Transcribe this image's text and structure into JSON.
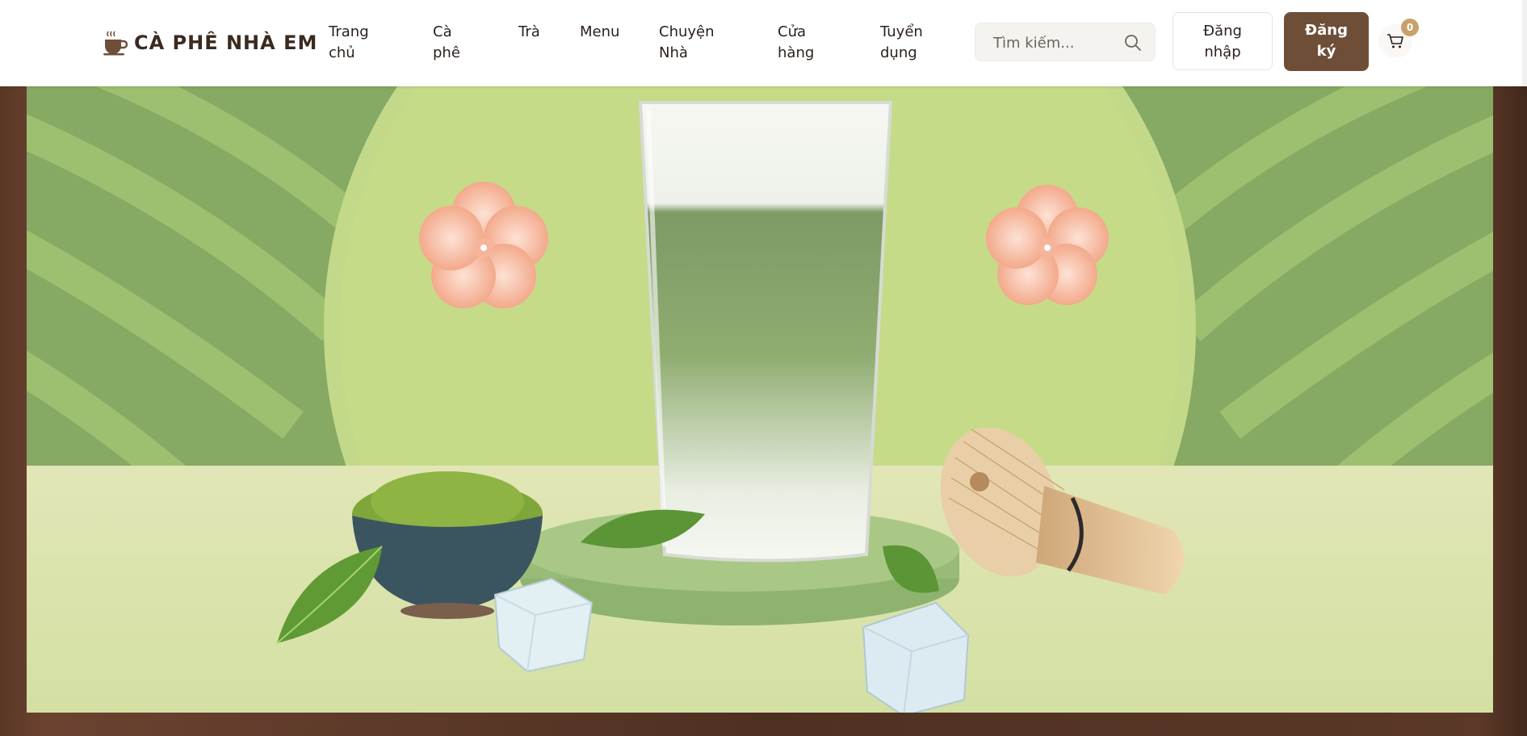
{
  "brand": {
    "name": "CÀ PHÊ NHÀ EM",
    "icon": "coffee-cup-icon"
  },
  "nav": [
    {
      "label": "Trang\nchủ"
    },
    {
      "label": "Cà\nphê"
    },
    {
      "label": "Trà"
    },
    {
      "label": "Menu"
    },
    {
      "label": "Chuyện\nNhà"
    },
    {
      "label": "Cửa\nhàng"
    },
    {
      "label": "Tuyển\ndụng"
    }
  ],
  "search": {
    "placeholder": "Tìm kiếm...",
    "icon": "search-icon"
  },
  "auth": {
    "login_label": "Đăng\nnhập",
    "register_label": "Đăng\nký"
  },
  "cart": {
    "count": "0",
    "icon": "cart-icon"
  },
  "hero": {
    "image": "matcha-iced-drink-banner"
  },
  "colors": {
    "brand_brown": "#6f4e37",
    "badge": "#c9a06b",
    "background": "#4e3022",
    "hero_green": "#86a963"
  }
}
